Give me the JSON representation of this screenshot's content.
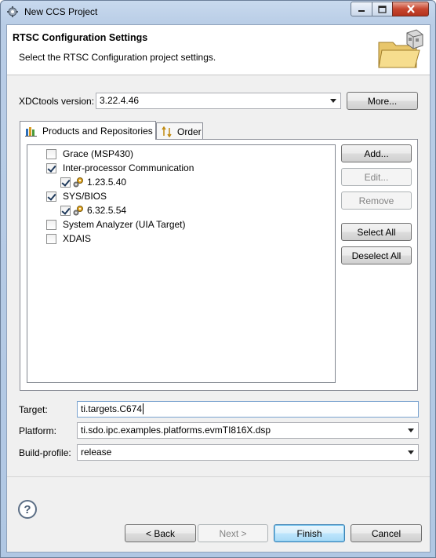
{
  "window": {
    "title": "New CCS Project",
    "controls": {
      "minimize_icon": "minimize-icon",
      "maximize_icon": "maximize-icon",
      "close_icon": "close-icon"
    }
  },
  "header": {
    "title": "RTSC Configuration Settings",
    "subtitle": "Select the RTSC Configuration project settings."
  },
  "xdctools": {
    "label": "XDCtools version:",
    "value": "3.22.4.46",
    "more_button": "More..."
  },
  "tabs": [
    {
      "label": "Products and Repositories",
      "active": true
    },
    {
      "label": "Order",
      "active": false
    }
  ],
  "tree": {
    "items": [
      {
        "label": "Grace (MSP430)",
        "checked": false,
        "level": 0,
        "icon": ""
      },
      {
        "label": "Inter-processor Communication",
        "checked": true,
        "level": 0,
        "icon": ""
      },
      {
        "label": "1.23.5.40",
        "checked": true,
        "level": 1,
        "icon": "package-gear-icon"
      },
      {
        "label": "SYS/BIOS",
        "checked": true,
        "level": 0,
        "icon": ""
      },
      {
        "label": "6.32.5.54",
        "checked": true,
        "level": 1,
        "icon": "package-gear-icon"
      },
      {
        "label": "System Analyzer (UIA Target)",
        "checked": false,
        "level": 0,
        "icon": ""
      },
      {
        "label": "XDAIS",
        "checked": false,
        "level": 0,
        "icon": ""
      }
    ]
  },
  "side_buttons": {
    "add": "Add...",
    "edit": "Edit...",
    "remove": "Remove",
    "select_all": "Select All",
    "deselect_all": "Deselect All"
  },
  "target": {
    "label": "Target:",
    "value": "ti.targets.C674"
  },
  "platform": {
    "label": "Platform:",
    "value": "ti.sdo.ipc.examples.platforms.evmTI816X.dsp"
  },
  "build_profile": {
    "label": "Build-profile:",
    "value": "release"
  },
  "footer": {
    "help_icon": "?",
    "back": "< Back",
    "next": "Next >",
    "finish": "Finish",
    "cancel": "Cancel"
  }
}
